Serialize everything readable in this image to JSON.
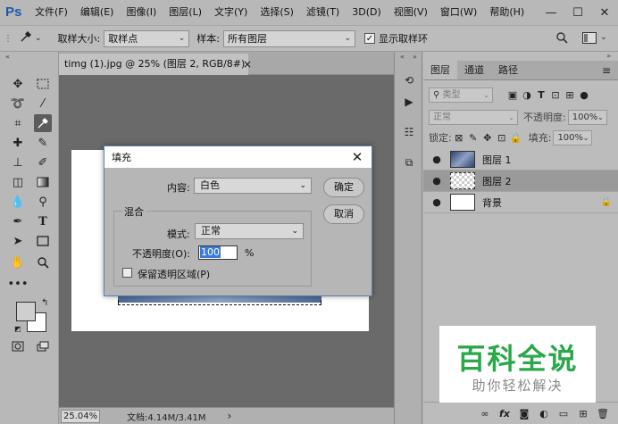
{
  "app": {
    "logo": "Ps"
  },
  "menu": [
    "文件(F)",
    "编辑(E)",
    "图像(I)",
    "图层(L)",
    "文字(Y)",
    "选择(S)",
    "滤镜(T)",
    "3D(D)",
    "视图(V)",
    "窗口(W)",
    "帮助(H)"
  ],
  "window_controls": {
    "minimize": "—",
    "maximize": "☐",
    "close": "✕"
  },
  "options_bar": {
    "sample_size_label": "取样大小:",
    "sample_size_value": "取样点",
    "sample_label": "样本:",
    "sample_value": "所有图层",
    "show_ring_label": "显示取样环",
    "show_ring_checked": "✓"
  },
  "document": {
    "tab_title": "timg (1).jpg @ 25% (图层 2, RGB/8#) *",
    "tab_close": "×",
    "zoom": "25.04%",
    "doc_info": "文档:4.14M/3.41M",
    "status_arrow": "›"
  },
  "layers_panel": {
    "tabs": [
      "图层",
      "通道",
      "路径"
    ],
    "filter_placeholder": "类型",
    "blend_mode": "正常",
    "opacity_label": "不透明度:",
    "opacity_value": "100%",
    "lock_label": "锁定:",
    "fill_label": "填充:",
    "fill_value": "100%",
    "layers": [
      {
        "name": "图层 1",
        "visible": "●",
        "selected": false
      },
      {
        "name": "图层 2",
        "visible": "●",
        "selected": true
      },
      {
        "name": "背景",
        "visible": "●",
        "selected": false,
        "locked": "🔒"
      }
    ]
  },
  "fill_dialog": {
    "title": "填充",
    "close": "✕",
    "content_label": "内容:",
    "content_value": "白色",
    "ok_label": "确定",
    "cancel_label": "取消",
    "blend_group_title": "混合",
    "mode_label": "模式:",
    "mode_value": "正常",
    "opacity_label": "不透明度(O):",
    "opacity_value": "100",
    "percent": "%",
    "preserve_label": "保留透明区域(P)"
  },
  "watermark": {
    "title": "百科全说",
    "subtitle": "助你轻松解决"
  },
  "colors": {
    "accent_blue": "#3d7ad6",
    "watermark_green": "#2aa84a",
    "ps_logo_blue": "#1a5aa8"
  }
}
